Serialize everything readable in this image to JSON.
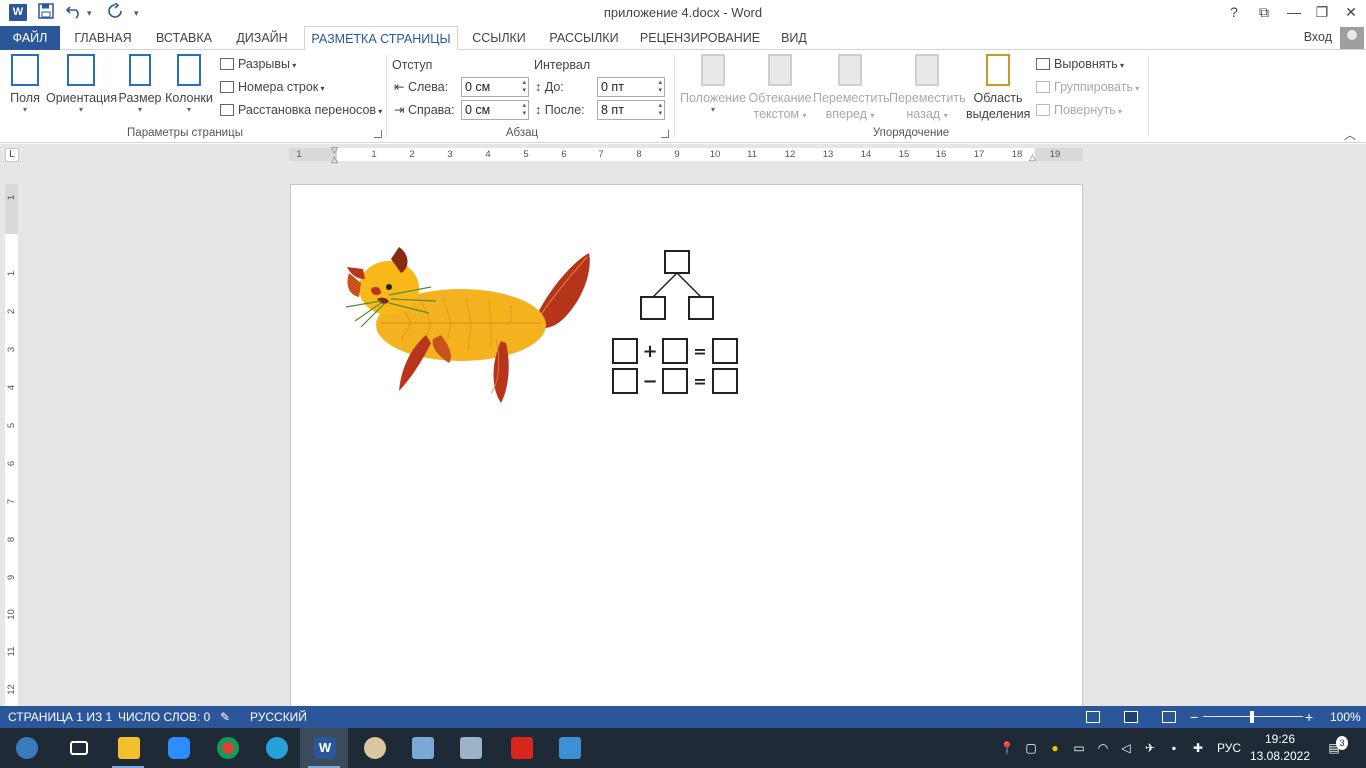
{
  "titlebar": {
    "title": "приложение 4.docx - Word",
    "app_icon": "W",
    "help": "?",
    "ribbon_display": "⧉",
    "minimize": "—",
    "restore": "❐",
    "close": "✕",
    "qat": {
      "save_icon": "save-icon",
      "undo_icon": "undo-icon",
      "redo_icon": "redo-icon",
      "customize": "▾"
    }
  },
  "tabs": {
    "file": "ФАЙЛ",
    "home": "ГЛАВНАЯ",
    "insert": "ВСТАВКА",
    "design": "ДИЗАЙН",
    "layout": "РАЗМЕТКА СТРАНИЦЫ",
    "references": "ССЫЛКИ",
    "mailings": "РАССЫЛКИ",
    "review": "РЕЦЕНЗИРОВАНИЕ",
    "view": "ВИД",
    "signin": "Вход"
  },
  "ribbon": {
    "page_setup": {
      "label": "Параметры страницы",
      "margins": "Поля",
      "orientation": "Ориентация",
      "size": "Размер",
      "columns": "Колонки",
      "breaks": "Разрывы",
      "line_numbers": "Номера строк",
      "hyphenation": "Расстановка переносов"
    },
    "paragraph": {
      "label": "Абзац",
      "indent_header": "Отступ",
      "spacing_header": "Интервал",
      "left_label": "Слева:",
      "left_value": "0 см",
      "right_label": "Справа:",
      "right_value": "0 см",
      "before_label": "До:",
      "before_value": "0 пт",
      "after_label": "После:",
      "after_value": "8 пт"
    },
    "arrange": {
      "label": "Упорядочение",
      "position": "Положение",
      "wrap_text_1": "Обтекание",
      "wrap_text_2": "текстом",
      "bring_forward_1": "Переместить",
      "bring_forward_2": "вперед",
      "send_backward_1": "Переместить",
      "send_backward_2": "назад",
      "selection_pane_1": "Область",
      "selection_pane_2": "выделения",
      "align": "Выровнять",
      "group": "Группировать",
      "rotate": "Повернуть"
    }
  },
  "ruler": {
    "tab_selector": "L",
    "h_numbers": [
      "1",
      "1",
      "2",
      "3",
      "4",
      "5",
      "6",
      "7",
      "8",
      "9",
      "10",
      "11",
      "12",
      "13",
      "14",
      "15",
      "16",
      "17",
      "18",
      "19"
    ],
    "v_numbers": [
      "1",
      "1",
      "2",
      "3",
      "4",
      "5",
      "6",
      "7",
      "8",
      "9",
      "10",
      "11",
      "12"
    ]
  },
  "document": {
    "diagram": {
      "ops": [
        "+",
        "=",
        "−",
        "="
      ]
    }
  },
  "statusbar": {
    "page": "СТРАНИЦА 1 ИЗ 1",
    "words": "ЧИСЛО СЛОВ: 0",
    "language": "РУССКИЙ",
    "zoom_minus": "−",
    "zoom_plus": "+",
    "zoom": "100%",
    "zoom_level": 1.0
  },
  "taskbar": {
    "apps": [
      "start-icon",
      "task-view-icon",
      "file-explorer-icon",
      "zoom-icon",
      "chrome-icon",
      "network-app-icon",
      "word-icon",
      "paint-icon",
      "scanner-icon",
      "archive-icon",
      "pdf-icon",
      "photos-icon"
    ],
    "lang": "РУС",
    "time": "19:26",
    "date": "13.08.2022",
    "notifications": "3",
    "colors": {
      "taskbar_bg": "#1e2a36",
      "word_blue": "#2b579a"
    }
  }
}
